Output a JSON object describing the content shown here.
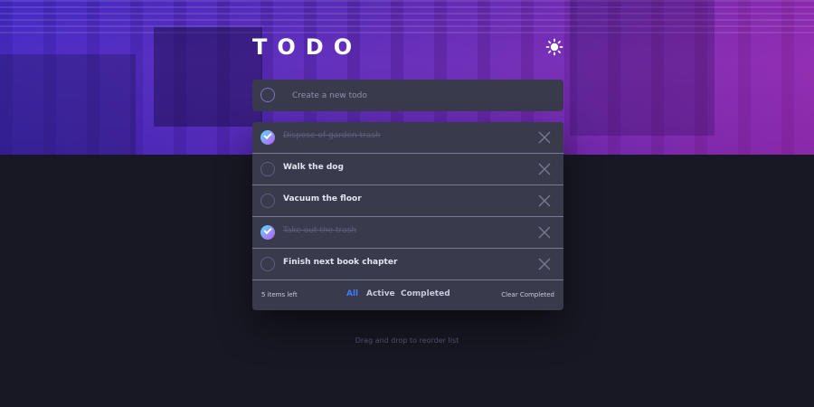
{
  "app": {
    "title": "TODO",
    "theme_toggle_icon": "sun-icon"
  },
  "new_todo": {
    "placeholder": "Create a new todo",
    "value": ""
  },
  "todos": [
    {
      "label": "Dispose of garden trash",
      "completed": true
    },
    {
      "label": "Walk the dog",
      "completed": false
    },
    {
      "label": "Vacuum the floor",
      "completed": false
    },
    {
      "label": "Take out the trash",
      "completed": true
    },
    {
      "label": "Finish next book chapter",
      "completed": false
    }
  ],
  "footer": {
    "items_left": "5 items left",
    "filters": {
      "all": "All",
      "active": "Active",
      "completed": "Completed"
    },
    "selected_filter": "All",
    "clear_completed": "Clear Completed"
  },
  "hint": "Drag and drop to reorder list",
  "colors": {
    "background": "#171823",
    "card": "#393a4b",
    "accent": "#3a7cfd",
    "check_gradient_start": "#55ddff",
    "check_gradient_end": "#c058f3"
  }
}
